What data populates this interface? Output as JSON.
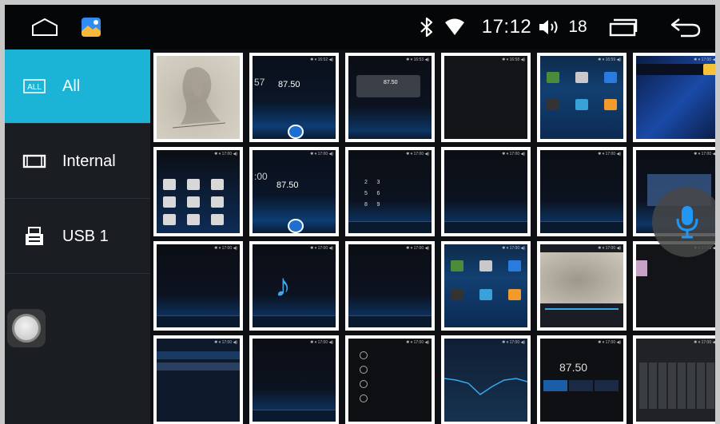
{
  "status_bar": {
    "time": "17:12",
    "volume": "18",
    "icons": [
      "home-icon",
      "gallery-app-icon",
      "bluetooth-icon",
      "wifi-icon",
      "volume-icon",
      "recents-icon",
      "back-icon"
    ]
  },
  "sidebar": {
    "items": [
      {
        "label": "All",
        "icon": "all-icon",
        "active": true
      },
      {
        "label": "Internal",
        "icon": "internal-storage-icon",
        "active": false
      },
      {
        "label": "USB 1",
        "icon": "usb-icon",
        "active": false
      }
    ]
  },
  "colors": {
    "accent": "#1bb3d6",
    "sidebar_bg": "#1a1d22",
    "statusbar_bg": "#050607",
    "thumb_border": "#ffffff",
    "mic_blue": "#2196f3"
  },
  "grid": {
    "thumbnails": [
      {
        "kind": "sketch-portrait"
      },
      {
        "kind": "radio",
        "freq": "87.50"
      },
      {
        "kind": "radio-dashboard",
        "freq": "87.50"
      },
      {
        "kind": "blank-dark"
      },
      {
        "kind": "app-grid"
      },
      {
        "kind": "hex-wallpaper"
      },
      {
        "kind": "car-brands"
      },
      {
        "kind": "radio",
        "freq": "87.50"
      },
      {
        "kind": "dialpad"
      },
      {
        "kind": "call-screen"
      },
      {
        "kind": "call-log"
      },
      {
        "kind": "dialog"
      },
      {
        "kind": "call-list"
      },
      {
        "kind": "music"
      },
      {
        "kind": "call-screen"
      },
      {
        "kind": "app-grid"
      },
      {
        "kind": "video-player"
      },
      {
        "kind": "dark-panel"
      },
      {
        "kind": "file-list"
      },
      {
        "kind": "settings-list"
      },
      {
        "kind": "menu-list"
      },
      {
        "kind": "equalizer"
      },
      {
        "kind": "radio-presets",
        "freq": "87.50"
      },
      {
        "kind": "keyboard"
      }
    ]
  },
  "voice_assistant": {
    "icon": "microphone-icon"
  }
}
